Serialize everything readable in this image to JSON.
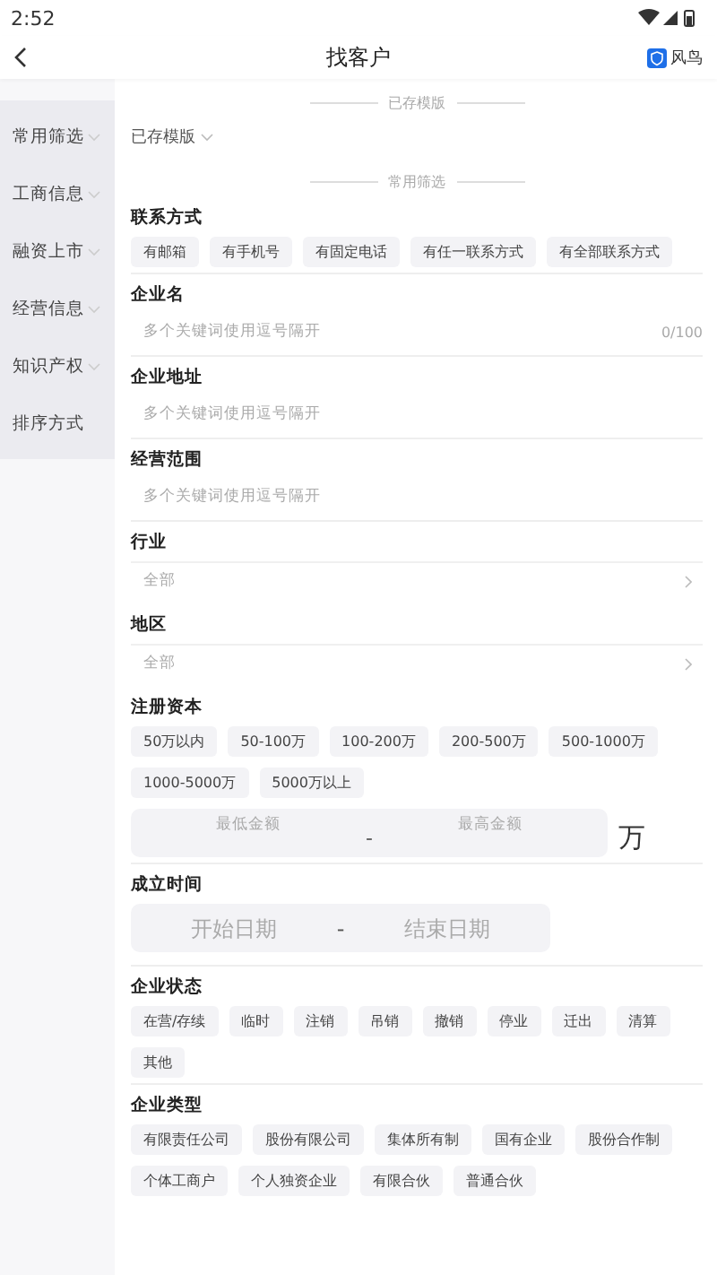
{
  "status_bar": {
    "time": "2:52"
  },
  "header": {
    "title": "找客户",
    "logo_text": "风鸟"
  },
  "sidebar": {
    "items": [
      {
        "label": "常用筛选",
        "expandable": true
      },
      {
        "label": "工商信息",
        "expandable": true
      },
      {
        "label": "融资上市",
        "expandable": true
      },
      {
        "label": "经营信息",
        "expandable": true
      },
      {
        "label": "知识产权",
        "expandable": true
      },
      {
        "label": "排序方式",
        "expandable": false
      }
    ]
  },
  "templates": {
    "divider": "已存模版",
    "dropdown": "已存模版"
  },
  "common_divider": "常用筛选",
  "sections": [
    {
      "kind": "chips",
      "title": "联系方式",
      "chips": [
        "有邮箱",
        "有手机号",
        "有固定电话",
        "有任一联系方式",
        "有全部联系方式"
      ]
    },
    {
      "kind": "input",
      "title": "企业名",
      "placeholder": "多个关键词使用逗号隔开",
      "counter": "0/100"
    },
    {
      "kind": "input",
      "title": "企业地址",
      "placeholder": "多个关键词使用逗号隔开"
    },
    {
      "kind": "input",
      "title": "经营范围",
      "placeholder": "多个关键词使用逗号隔开"
    },
    {
      "kind": "select",
      "title": "行业",
      "value": "全部"
    },
    {
      "kind": "select",
      "title": "地区",
      "value": "全部"
    },
    {
      "kind": "chips",
      "title": "注册资本",
      "chips": [
        "50万以内",
        "50-100万",
        "100-200万",
        "200-500万",
        "500-1000万",
        "1000-5000万",
        "5000万以上"
      ],
      "range": {
        "min_placeholder": "最低金额",
        "separator": "-",
        "max_placeholder": "最高金额",
        "unit": "万"
      }
    },
    {
      "kind": "date",
      "title": "成立时间",
      "start_placeholder": "开始日期",
      "separator": "-",
      "end_placeholder": "结束日期"
    },
    {
      "kind": "chips",
      "title": "企业状态",
      "chips": [
        "在营/存续",
        "临时",
        "注销",
        "吊销",
        "撤销",
        "停业",
        "迁出",
        "清算",
        "其他"
      ]
    },
    {
      "kind": "chips",
      "title": "企业类型",
      "chips": [
        "有限责任公司",
        "股份有限公司",
        "集体所有制",
        "国有企业",
        "股份合作制",
        "个体工商户",
        "个人独资企业",
        "有限合伙",
        "普通合伙"
      ]
    }
  ]
}
